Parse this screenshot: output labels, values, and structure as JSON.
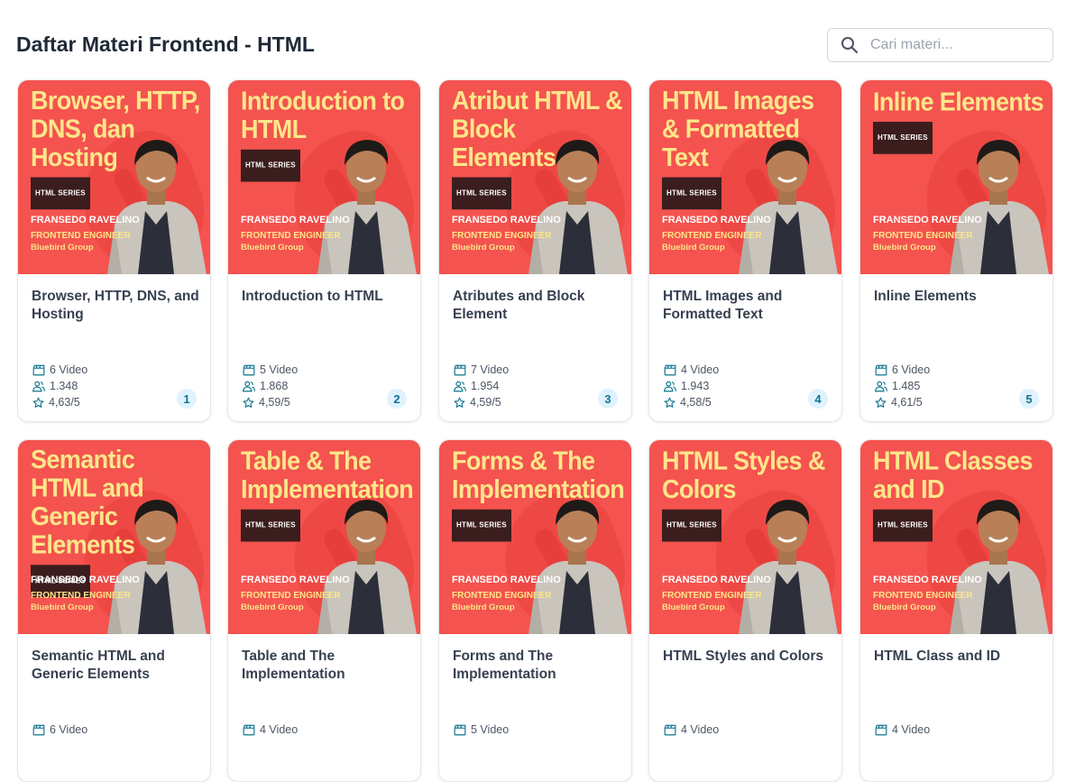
{
  "header": {
    "title": "Daftar Materi Frontend - HTML",
    "search_placeholder": "Cari materi..."
  },
  "thumbnail_common": {
    "series_label": "HTML SERIES",
    "presenter": "FRANSEDO RAVELINO",
    "role": "FRONTEND ENGINEER",
    "company": "Bluebird Group"
  },
  "colors": {
    "thumbnail_bg": "#f4534f",
    "thumbnail_title": "#fde68a",
    "icon_accent": "#0e7490",
    "badge_bg": "#e0f2fe"
  },
  "icons": {
    "video": "clapperboard-icon",
    "learners": "users-icon",
    "rating": "star-icon",
    "search": "search-icon"
  },
  "cards": [
    {
      "thumb_title": "Browser, HTTP, DNS, dan Hosting",
      "title": "Browser, HTTP, DNS, and Hosting",
      "videos": "6 Video",
      "learners": "1.348",
      "rating": "4,63/5",
      "number": "1"
    },
    {
      "thumb_title": "Introduction to HTML",
      "title": "Introduction to HTML",
      "videos": "5 Video",
      "learners": "1.868",
      "rating": "4,59/5",
      "number": "2"
    },
    {
      "thumb_title": "Atribut HTML & Block Elements",
      "title": "Atributes and Block Element",
      "videos": "7 Video",
      "learners": "1.954",
      "rating": "4,59/5",
      "number": "3"
    },
    {
      "thumb_title": "HTML Images & Formatted Text",
      "title": "HTML Images and Formatted Text",
      "videos": "4 Video",
      "learners": "1.943",
      "rating": "4,58/5",
      "number": "4"
    },
    {
      "thumb_title": "Inline Elements",
      "title": "Inline Elements",
      "videos": "6 Video",
      "learners": "1.485",
      "rating": "4,61/5",
      "number": "5"
    },
    {
      "thumb_title": "Semantic HTML and Generic Elements",
      "title": "Semantic HTML and Generic Elements",
      "videos": "6 Video"
    },
    {
      "thumb_title": "Table & The Implementation",
      "title": "Table and The Implementation",
      "videos": "4 Video"
    },
    {
      "thumb_title": "Forms & The Implementation",
      "title": "Forms and The Implementation",
      "videos": "5 Video"
    },
    {
      "thumb_title": "HTML Styles & Colors",
      "title": "HTML Styles and Colors",
      "videos": "4 Video"
    },
    {
      "thumb_title": "HTML Classes and ID",
      "title": "HTML Class and ID",
      "videos": "4 Video"
    }
  ]
}
